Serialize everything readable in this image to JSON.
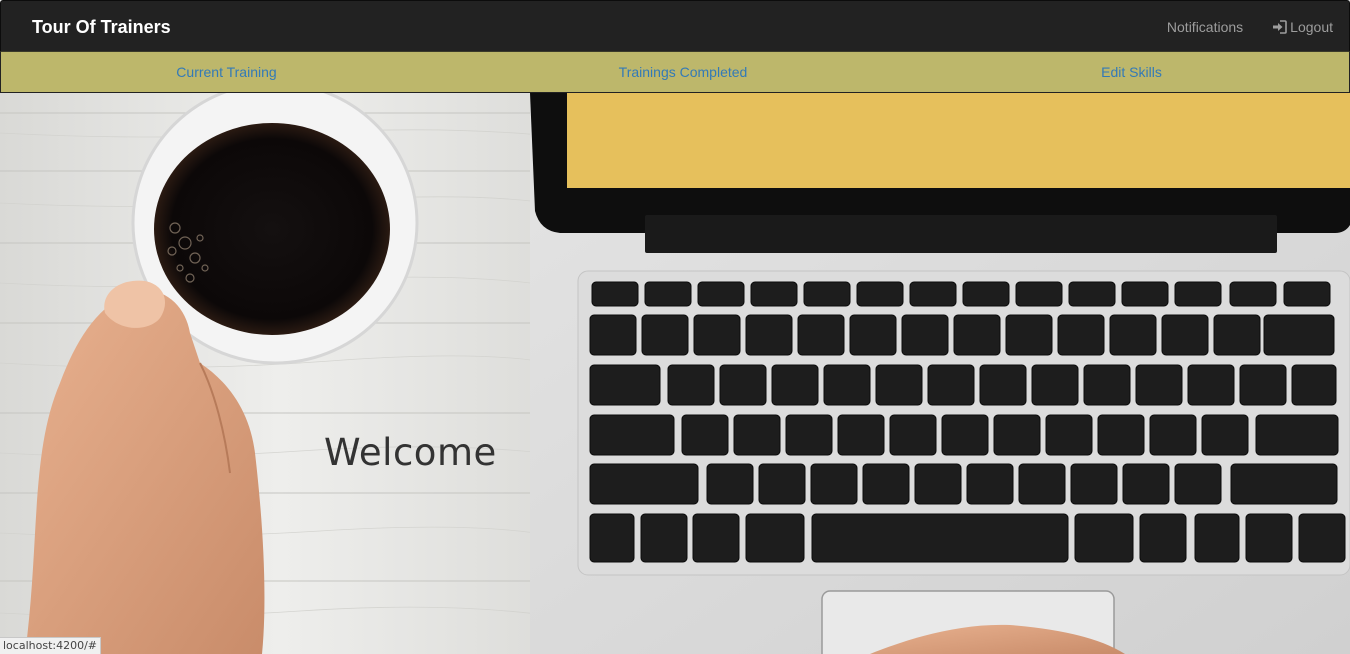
{
  "navbar": {
    "brand": "Tour Of Trainers",
    "notifications_label": "Notifications",
    "logout_label": "Logout"
  },
  "subnav": {
    "items": [
      {
        "label": "Current Training"
      },
      {
        "label": "Trainings Completed"
      },
      {
        "label": "Edit Skills"
      }
    ]
  },
  "hero": {
    "welcome_text": "Welcome",
    "image": "coffee-cup-and-laptop-keyboard-photo"
  },
  "status_bar": {
    "url": "localhost:4200/#"
  },
  "colors": {
    "navbar_bg": "#222222",
    "subnav_bg": "#bdb76b",
    "link": "#337ab7"
  }
}
